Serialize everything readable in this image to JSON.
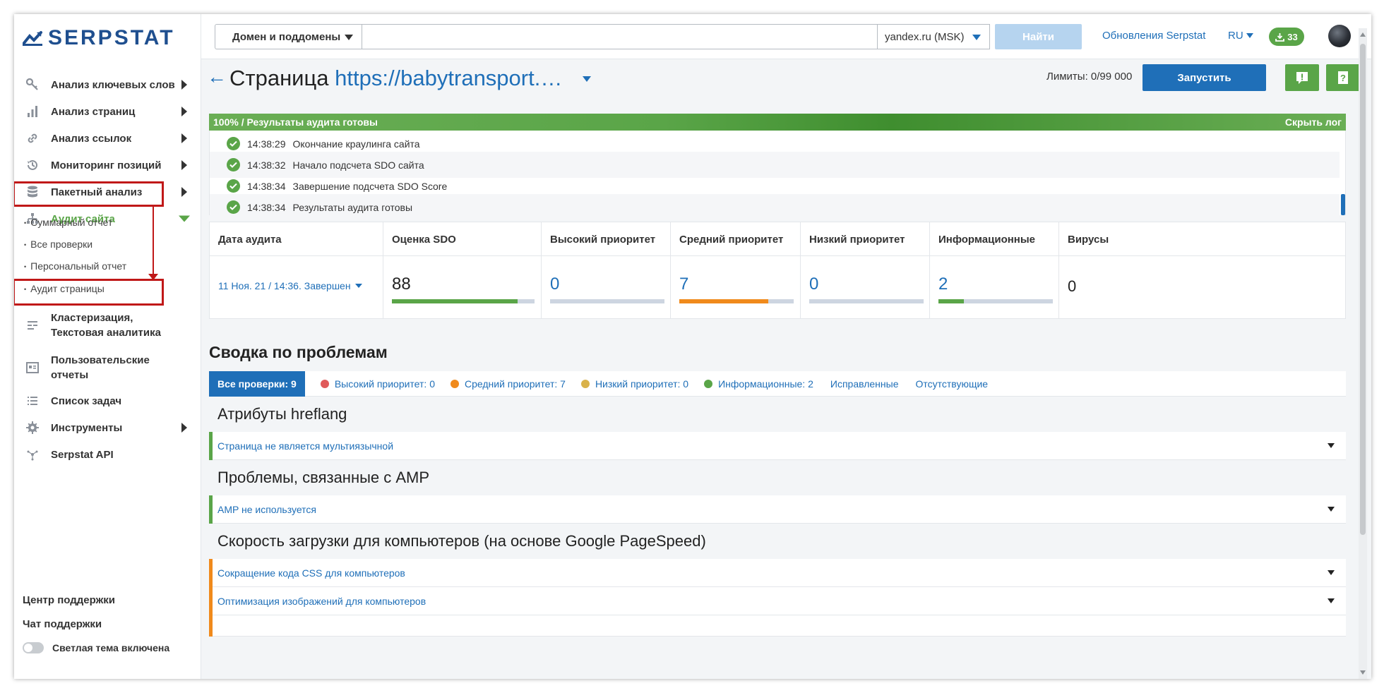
{
  "brand": {
    "name": "SERPSTAT"
  },
  "sidebar": {
    "items": [
      {
        "label": "Анализ ключевых слов",
        "icon": "key-icon"
      },
      {
        "label": "Анализ страниц",
        "icon": "bar-chart-icon"
      },
      {
        "label": "Анализ ссылок",
        "icon": "link-icon"
      },
      {
        "label": "Мониторинг позиций",
        "icon": "history-icon"
      },
      {
        "label": "Пакетный анализ",
        "icon": "database-icon"
      },
      {
        "label": "Аудит сайта",
        "icon": "sitemap-icon"
      }
    ],
    "subitems": [
      "Суммарный отчет",
      "Все проверки",
      "Персональный отчет",
      "Аудит страницы"
    ],
    "items2": [
      {
        "label": "Кластеризация,\nТекстовая аналитика",
        "line1": "Кластеризация,",
        "line2": "Текстовая аналитика",
        "icon": "text-analytics-icon"
      },
      {
        "label": "Пользовательские отчеты",
        "line1": "Пользовательские",
        "line2": "отчеты",
        "icon": "report-icon"
      },
      {
        "label": "Список задач",
        "icon": "list-icon"
      },
      {
        "label": "Инструменты",
        "icon": "gear-icon"
      },
      {
        "label": "Serpstat API",
        "icon": "api-icon"
      }
    ],
    "support_center": "Центр поддержки",
    "support_chat": "Чат поддержки",
    "theme_label": "Светлая тема включена"
  },
  "topbar": {
    "domain_mode": "Домен и поддомены",
    "search_value": "",
    "region": "yandex.ru (MSK)",
    "find_label": "Найти",
    "updates_link": "Обновления Serpstat",
    "lang": "RU",
    "downloads_count": "33"
  },
  "header": {
    "title_prefix": "Страница",
    "title_url": "https://babytransport.…",
    "limits": "Лимиты: 0/99 000",
    "run_label": "Запустить"
  },
  "progress": {
    "percent": 100,
    "text": "100% / Результаты аудита готовы",
    "hide_log": "Скрыть лог"
  },
  "log": [
    {
      "time": "14:38:29",
      "text": "Окончание краулинга сайта"
    },
    {
      "time": "14:38:32",
      "text": "Начало подсчета SDO сайта"
    },
    {
      "time": "14:38:34",
      "text": "Завершение подсчета SDO Score"
    },
    {
      "time": "14:38:34",
      "text": "Результаты аудита готовы"
    }
  ],
  "stats": {
    "audit_date_header": "Дата аудита",
    "audit_date_value": "11 Ноя. 21 / 14:36. Завершен",
    "columns": [
      {
        "header": "Оценка SDO",
        "value": "88",
        "fill": 0.88,
        "color": "#5aa548"
      },
      {
        "header": "Высокий приоритет",
        "value": "0",
        "fill": 0,
        "color": "#e05a5a"
      },
      {
        "header": "Средний приоритет",
        "value": "7",
        "fill": 0.78,
        "color": "#f08a1c"
      },
      {
        "header": "Низкий приоритет",
        "value": "0",
        "fill": 0,
        "color": "#d9b24a"
      },
      {
        "header": "Информационные",
        "value": "2",
        "fill": 0.22,
        "color": "#5aa548"
      },
      {
        "header": "Вирусы",
        "value": "0"
      }
    ]
  },
  "summary": {
    "title": "Сводка по проблемам",
    "filter_all": "Все проверки: 9",
    "filters": [
      {
        "label": "Высокий приоритет: 0",
        "color": "#e05a5a"
      },
      {
        "label": "Средний приоритет: 7",
        "color": "#f08a1c"
      },
      {
        "label": "Низкий приоритет: 0",
        "color": "#d9b24a"
      },
      {
        "label": "Информационные: 2",
        "color": "#5aa548"
      }
    ],
    "fixed": "Исправленные",
    "missing": "Отсутствующие"
  },
  "groups": [
    {
      "title": "Атрибуты hreflang",
      "issues": [
        {
          "label": "Страница не является мультиязычной",
          "color": "#5aa548"
        }
      ]
    },
    {
      "title": "Проблемы, связанные с AMP",
      "issues": [
        {
          "label": "AMP не используется",
          "color": "#5aa548"
        }
      ]
    },
    {
      "title": "Скорость загрузки для компьютеров (на основе Google PageSpeed)",
      "issues": [
        {
          "label": "Сокращение кода CSS для компьютеров",
          "color": "#f08a1c"
        },
        {
          "label": "Оптимизация изображений для компьютеров",
          "color": "#f08a1c"
        }
      ]
    }
  ]
}
